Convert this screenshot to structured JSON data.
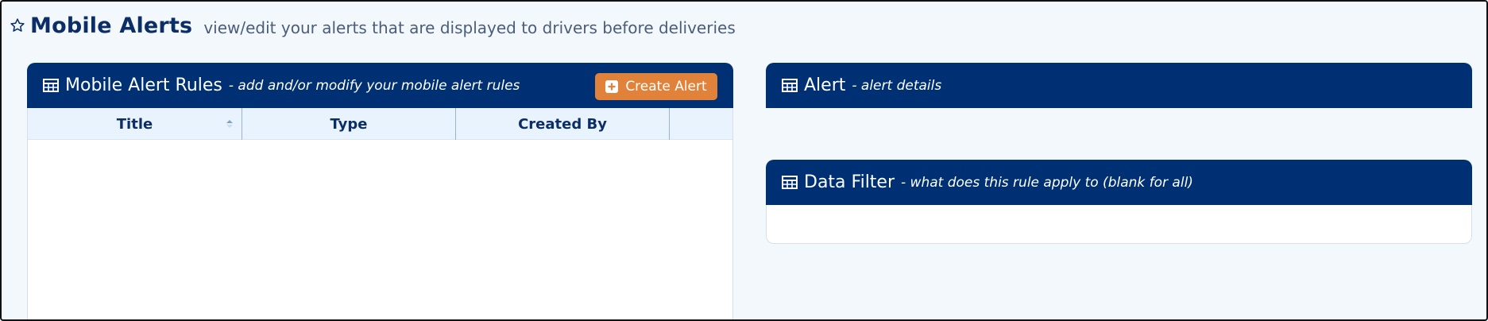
{
  "page": {
    "title": "Mobile Alerts",
    "subtitle": "view/edit your alerts that are displayed to drivers before deliveries",
    "icon": "star-icon"
  },
  "rules_panel": {
    "title": "Mobile Alert Rules",
    "description": "- add and/or modify your mobile alert rules",
    "icon": "grid-icon",
    "create_button": {
      "label": "Create Alert",
      "icon": "plus-square-icon",
      "color": "#e0823a"
    },
    "columns": [
      "Title",
      "Type",
      "Created By",
      ""
    ],
    "sorted_column": "Title",
    "rows": []
  },
  "alert_panel": {
    "title": "Alert",
    "description": "- alert details",
    "icon": "grid-icon"
  },
  "filter_panel": {
    "title": "Data Filter",
    "description": "- what does this rule apply to (blank for all)",
    "icon": "grid-icon"
  },
  "colors": {
    "header_bg": "#003074",
    "page_bg": "#f3f8fd",
    "table_head_bg": "#e9f3fd",
    "accent": "#e0823a",
    "title_text": "#0b2e66"
  }
}
